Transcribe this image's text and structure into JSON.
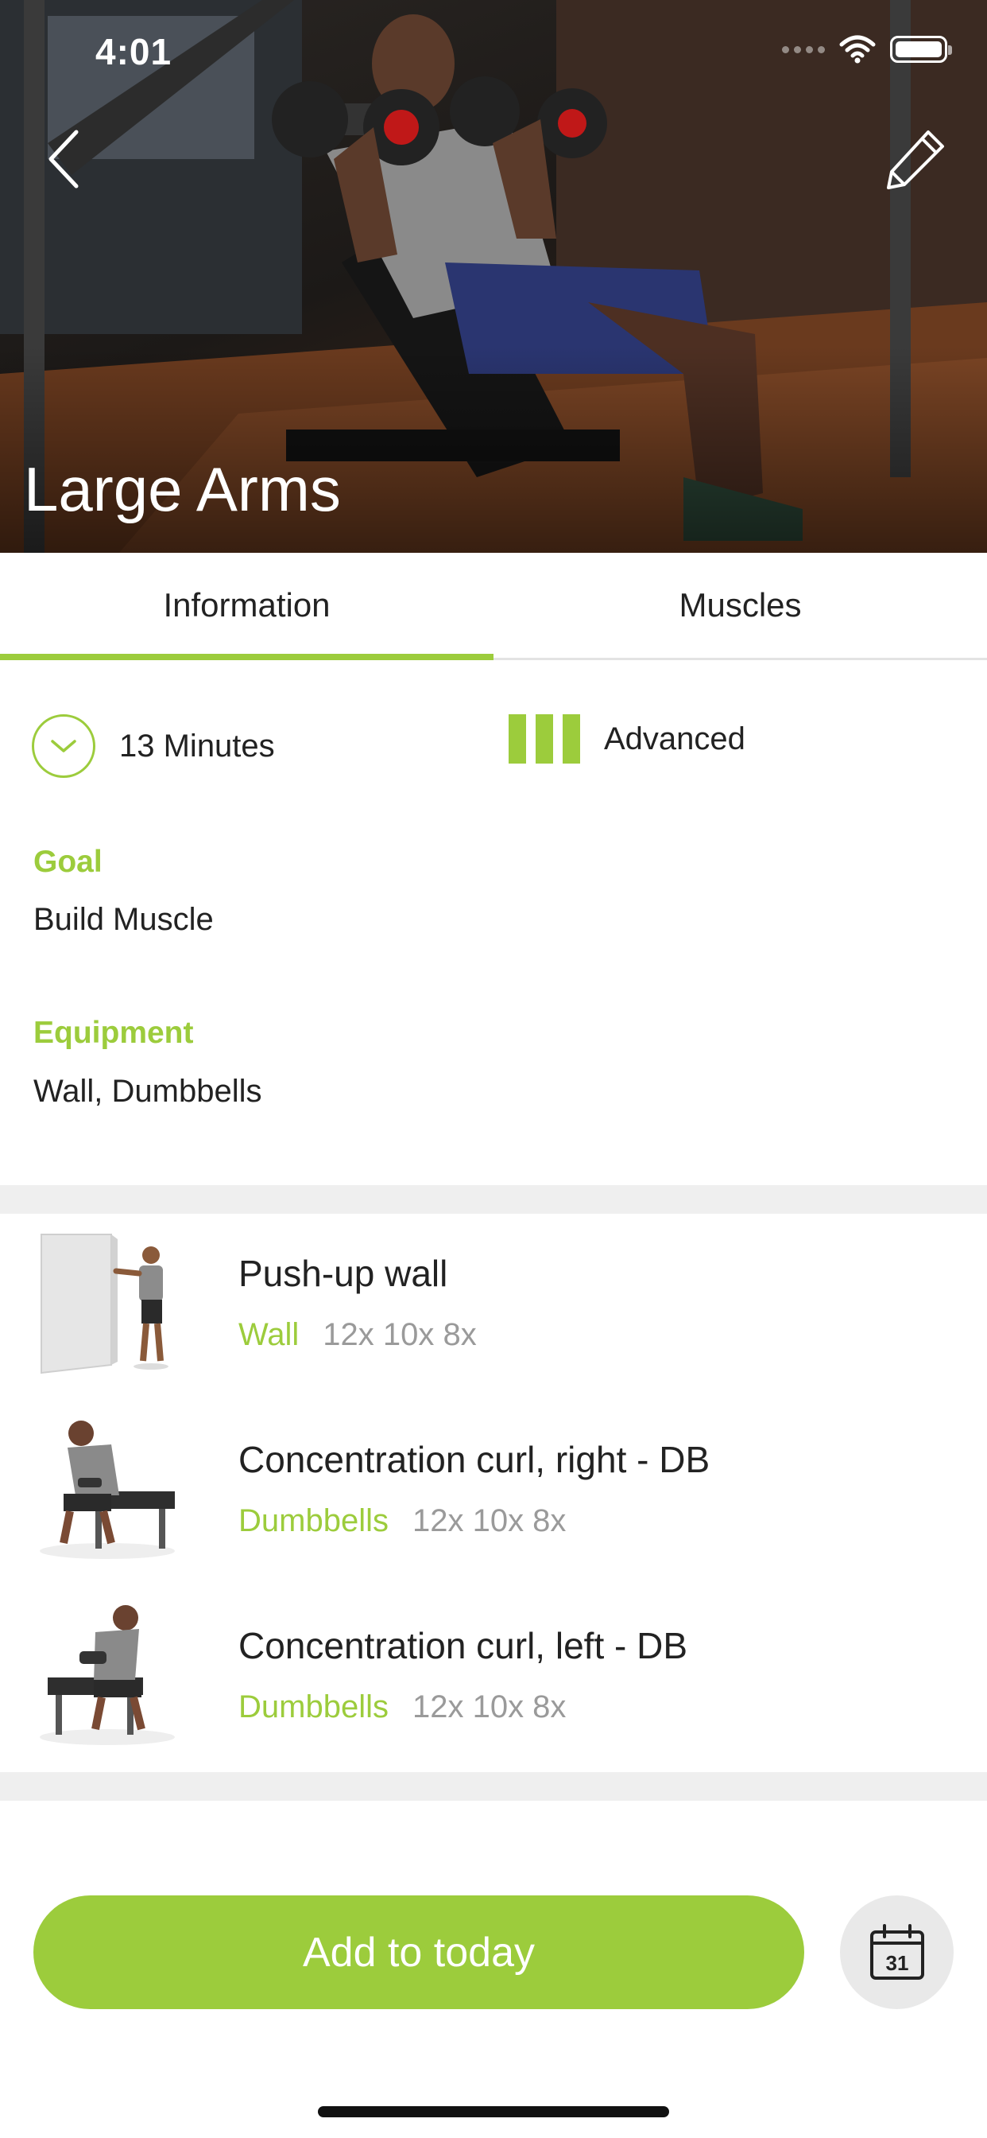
{
  "status_bar": {
    "time": "4:01"
  },
  "hero": {
    "title": "Large Arms"
  },
  "tabs": [
    {
      "label": "Information",
      "active": true
    },
    {
      "label": "Muscles",
      "active": false
    }
  ],
  "info": {
    "duration": "13 Minutes",
    "level": "Advanced",
    "goal_label": "Goal",
    "goal_value": "Build Muscle",
    "equipment_label": "Equipment",
    "equipment_value": "Wall, Dumbbells"
  },
  "exercises": [
    {
      "name": "Push-up wall",
      "equipment": "Wall",
      "reps": "12x 10x 8x"
    },
    {
      "name": "Concentration curl, right - DB",
      "equipment": "Dumbbells",
      "reps": "12x 10x 8x"
    },
    {
      "name": "Concentration curl, left - DB",
      "equipment": "Dumbbells",
      "reps": "12x 10x 8x"
    }
  ],
  "actions": {
    "add_label": "Add to today",
    "calendar_day": "31"
  },
  "colors": {
    "accent": "#9ccc3c",
    "divider": "#efefef"
  },
  "icons": [
    "back-icon",
    "edit-icon",
    "clock-icon",
    "level-icon",
    "calendar-icon",
    "wifi-icon",
    "battery-icon"
  ]
}
